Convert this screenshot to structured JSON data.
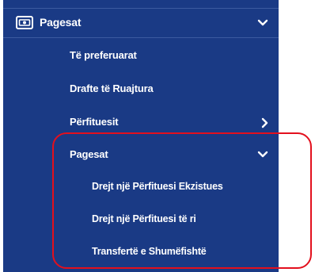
{
  "menu": {
    "header": {
      "label": "Pagesat",
      "icon": "money-bill-icon",
      "expanded": true
    },
    "items": [
      {
        "label": "Të preferuarat"
      },
      {
        "label": "Drafte të Ruajtura"
      },
      {
        "label": "Përfituesit",
        "has_submenu": true,
        "expanded": false
      },
      {
        "label": "Pagesat",
        "has_submenu": true,
        "expanded": true
      }
    ],
    "subitems": [
      {
        "label": "Drejt një Përfituesi Ekzistues"
      },
      {
        "label": "Drejt një Përfituesi të ri"
      },
      {
        "label": "Transfertë e Shumëfishtë"
      }
    ]
  },
  "colors": {
    "menu_background": "#1a3a85",
    "text": "#ffffff",
    "highlight_border": "#e3101d"
  }
}
